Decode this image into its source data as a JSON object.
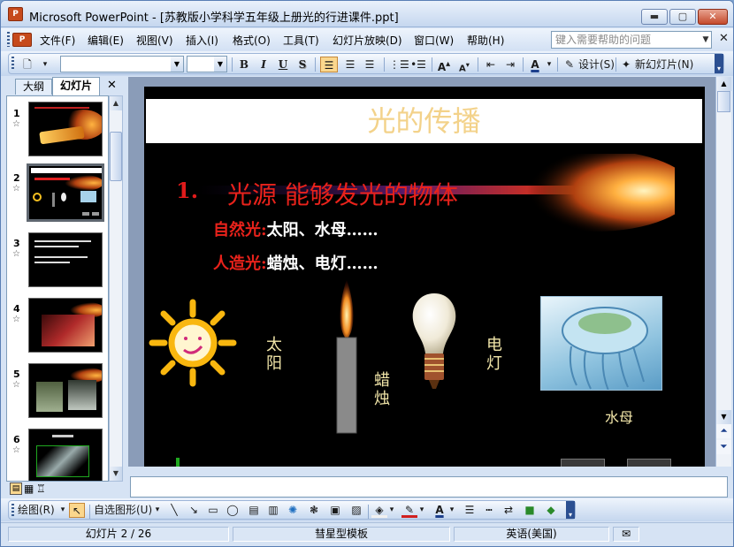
{
  "window": {
    "app_icon": "P",
    "title": "Microsoft PowerPoint - [苏教版小学科学五年级上册光的行进课件.ppt]",
    "minimize": "▬",
    "maximize": "▢",
    "close": "✕"
  },
  "menu": {
    "doc_icon": "P",
    "items": [
      "文件(F)",
      "编辑(E)",
      "视图(V)",
      "插入(I)",
      "格式(O)",
      "工具(T)",
      "幻灯片放映(D)",
      "窗口(W)",
      "帮助(H)"
    ],
    "help_placeholder": "键入需要帮助的问题",
    "help_close": "✕"
  },
  "toolbar": {
    "font_value": "",
    "size_value": "",
    "bold": "B",
    "italic": "I",
    "underline": "U",
    "shadow": "S",
    "design_label": "设计(S)",
    "new_slide_label": "新幻灯片(N)"
  },
  "leftpane": {
    "tab_outline": "大纲",
    "tab_slides": "幻灯片",
    "close": "✕",
    "thumbs": [
      {
        "num": "1"
      },
      {
        "num": "2",
        "selected": true
      },
      {
        "num": "3"
      },
      {
        "num": "4"
      },
      {
        "num": "5"
      },
      {
        "num": "6"
      }
    ]
  },
  "slide": {
    "title": "光的传播",
    "heading_num": "1.",
    "heading_text": "光源  能够发光的物体",
    "line1_label": "自然光:",
    "line1_value": "太阳、水母……",
    "line2_label": "人造光:",
    "line2_value": "蜡烛、电灯……",
    "label_sun": "太阳",
    "label_candle": "蜡烛",
    "label_bulb": "电灯",
    "label_jelly": "水母"
  },
  "drawbar": {
    "draw_label": "绘图(R)",
    "autoshape_label": "自选图形(U)"
  },
  "status": {
    "slide_info": "幻灯片 2 / 26",
    "template": "彗星型模板",
    "language": "英语(美国)"
  },
  "colors": {
    "title_text": "#f3d28a",
    "heading_red": "#e8221b",
    "label_yellow": "#f2e6a9",
    "selection_orange": "#fbd78d"
  }
}
